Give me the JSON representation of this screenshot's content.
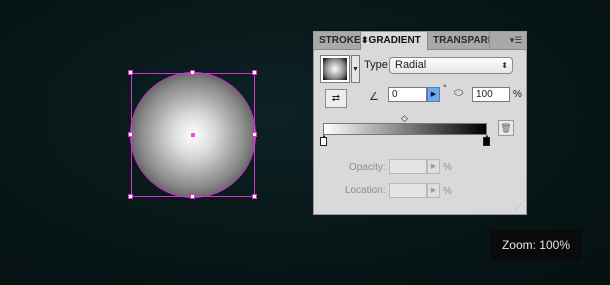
{
  "panel": {
    "tabs": [
      {
        "label": "STROKE"
      },
      {
        "label": "GRADIENT"
      },
      {
        "label": "TRANSPARE"
      }
    ],
    "active_tab_marker": "⬍",
    "menu_icon": "panel-menu-icon",
    "type_label": "Type",
    "type_value": "Radial",
    "angle_value": "0",
    "angle_degree": "°",
    "aspect_value": "100",
    "aspect_unit": "%",
    "opacity_label": "Opacity:",
    "opacity_unit": "%",
    "location_label": "Location:",
    "location_unit": "%"
  },
  "zoom": {
    "text": "Zoom: 100%"
  },
  "colors": {
    "selection": "#d633d6",
    "active_dropdown": "#6fa9e6",
    "canvas_bg": "#081617"
  }
}
